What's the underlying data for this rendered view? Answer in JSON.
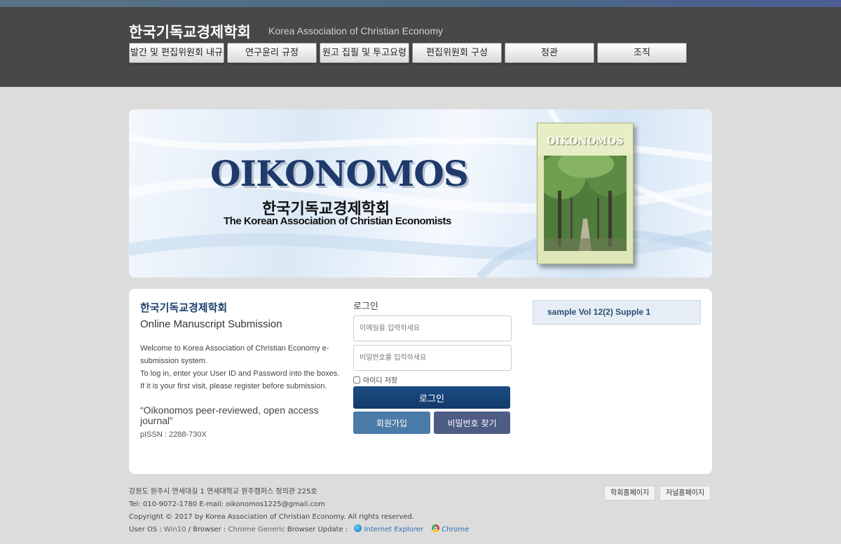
{
  "header": {
    "title": "한국기독교경제학회",
    "subtitle": "Korea Association of Christian Economy",
    "nav": [
      "발간 및 편집위원회 내규",
      "연구윤리 규정",
      "원고 집필 및 투고요령",
      "편집위원회 구성",
      "정관",
      "조직"
    ]
  },
  "banner": {
    "logo": "OIKONOMOS",
    "korean": "한국기독교경제학회",
    "english": "The Korean Association of Christian Economists",
    "cover_title": "OIKONOMOS"
  },
  "intro": {
    "org_name": "한국기독교경제학회",
    "heading": "Online Manuscript Submission",
    "welcome_1": "Welcome to Korea Association of Christian Economy e-submission system.",
    "welcome_2": "To log in, enter your User ID and Password into the boxes.",
    "welcome_3": "If it is your first visit, please register before submission.",
    "quote": "“Oikonomos peer-reviewed, open access journal”",
    "issn": "pISSN : 2288-730X"
  },
  "login": {
    "title": "로그인",
    "email_placeholder": "이메일을 입력하세요",
    "password_placeholder": "비밀번호를 입력하세요",
    "remember_label": "아이디 저장",
    "login_button": "로그인",
    "join_button": "회원가입",
    "find_button": "비밀번호 찾기"
  },
  "sample": {
    "label": "sample Vol 12(2) Supple 1"
  },
  "footer": {
    "address": "강원도 원주시 연세대길 1 연세대학교 원주캠퍼스 정의관 225호",
    "contact": "Tel: 010-9072-1780 E-mail: oikonomos1225@gmail.com",
    "copyright": "Copyright © 2017 by Korea Association of Christian Economy. All rights reserved.",
    "os_label": "User OS : ",
    "os_value": "Win10",
    "browser_label": " / Browser : ",
    "browser_value": "Chrome Generic",
    "update_label": " Browser Update : ",
    "ie_link": "Internet Explorer",
    "chrome_link": "Chrome",
    "society_home": "학회홈페이지",
    "journal_home": "저널홈페이지"
  },
  "colors": {
    "header_bg": "#484848",
    "page_bg": "#dcdcdc",
    "login_button": "#1b4c84",
    "join_button": "#4b7ca9",
    "find_button": "#4e5c86"
  }
}
